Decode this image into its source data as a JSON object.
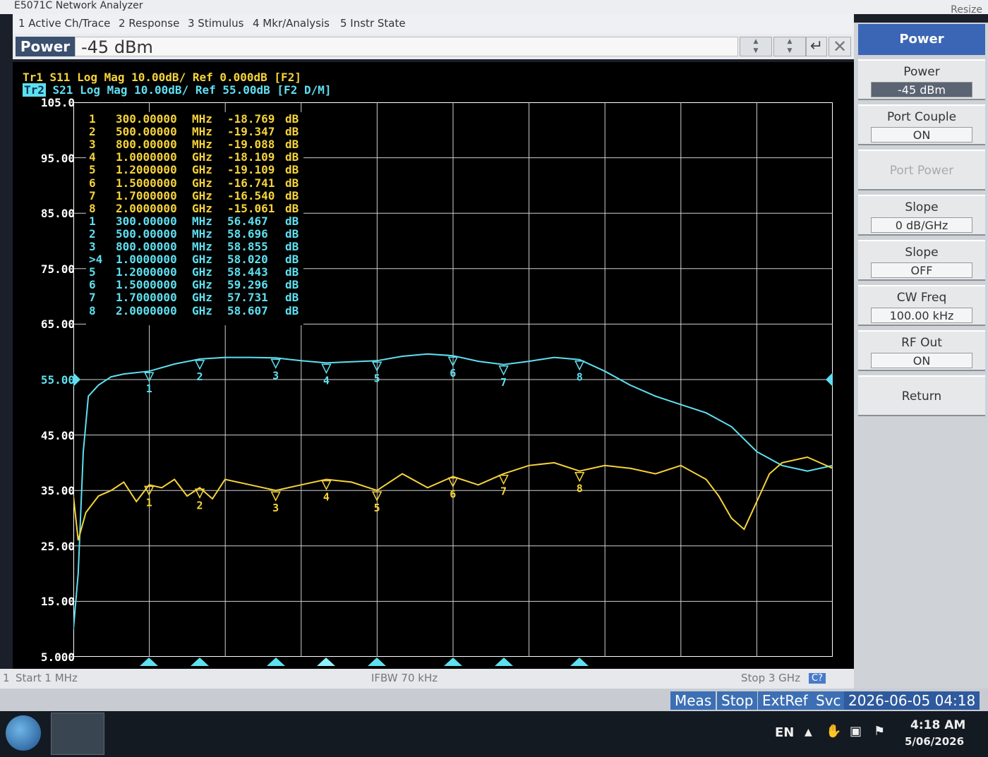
{
  "app": {
    "title": "E5071C Network Analyzer",
    "resize_label": "Resize"
  },
  "menu": [
    {
      "label": "1 Active Ch/Trace"
    },
    {
      "label": "2 Response"
    },
    {
      "label": "3 Stimulus"
    },
    {
      "label": "4 Mkr/Analysis"
    },
    {
      "label": "5 Instr State"
    }
  ],
  "entry": {
    "label": "Power",
    "value": "-45 dBm",
    "enter_icon": "enter-arrow-icon",
    "close_icon": "close-x-icon"
  },
  "traces": {
    "tr1": {
      "tag": "Tr1",
      "text": " S11 Log Mag 10.00dB/ Ref 0.000dB [F2]",
      "color": "#f5d33a"
    },
    "tr2": {
      "tag": "Tr2",
      "text": " S21 Log Mag 10.00dB/ Ref 55.00dB [F2 D/M]",
      "color": "#5ee0f0"
    }
  },
  "yaxis": {
    "labels": [
      "105.0",
      "95.00",
      "85.00",
      "75.00",
      "65.00",
      "55.00",
      "45.00",
      "35.00",
      "25.00",
      "15.00",
      "5.000"
    ],
    "reference": "55.00"
  },
  "markers_s11": [
    {
      "n": "1",
      "freq": "300.00000",
      "unit": "MHz",
      "value": "-18.769",
      "db": "dB"
    },
    {
      "n": "2",
      "freq": "500.00000",
      "unit": "MHz",
      "value": "-19.347",
      "db": "dB"
    },
    {
      "n": "3",
      "freq": "800.00000",
      "unit": "MHz",
      "value": "-19.088",
      "db": "dB"
    },
    {
      "n": "4",
      "freq": "1.0000000",
      "unit": "GHz",
      "value": "-18.109",
      "db": "dB"
    },
    {
      "n": "5",
      "freq": "1.2000000",
      "unit": "GHz",
      "value": "-19.109",
      "db": "dB"
    },
    {
      "n": "6",
      "freq": "1.5000000",
      "unit": "GHz",
      "value": "-16.741",
      "db": "dB"
    },
    {
      "n": "7",
      "freq": "1.7000000",
      "unit": "GHz",
      "value": "-16.540",
      "db": "dB"
    },
    {
      "n": "8",
      "freq": "2.0000000",
      "unit": "GHz",
      "value": "-15.061",
      "db": "dB"
    }
  ],
  "markers_s21": [
    {
      "n": "1",
      "freq": "300.00000",
      "unit": "MHz",
      "value": "56.467",
      "db": "dB"
    },
    {
      "n": "2",
      "freq": "500.00000",
      "unit": "MHz",
      "value": "58.696",
      "db": "dB"
    },
    {
      "n": "3",
      "freq": "800.00000",
      "unit": "MHz",
      "value": "58.855",
      "db": "dB"
    },
    {
      "n": ">4",
      "freq": "1.0000000",
      "unit": "GHz",
      "value": "58.020",
      "db": "dB"
    },
    {
      "n": "5",
      "freq": "1.2000000",
      "unit": "GHz",
      "value": "58.443",
      "db": "dB"
    },
    {
      "n": "6",
      "freq": "1.5000000",
      "unit": "GHz",
      "value": "59.296",
      "db": "dB"
    },
    {
      "n": "7",
      "freq": "1.7000000",
      "unit": "GHz",
      "value": "57.731",
      "db": "dB"
    },
    {
      "n": "8",
      "freq": "2.0000000",
      "unit": "GHz",
      "value": "58.607",
      "db": "dB"
    }
  ],
  "chart_data": {
    "type": "line",
    "xlim": [
      0.001,
      3.0
    ],
    "ylim": [
      5,
      105
    ],
    "x_unit": "GHz",
    "series": [
      {
        "name": "S21",
        "color": "#5ee0f0",
        "x": [
          0.001,
          0.02,
          0.04,
          0.06,
          0.1,
          0.15,
          0.2,
          0.3,
          0.4,
          0.5,
          0.6,
          0.7,
          0.8,
          0.9,
          1.0,
          1.1,
          1.2,
          1.3,
          1.4,
          1.5,
          1.6,
          1.7,
          1.8,
          1.9,
          2.0,
          2.1,
          2.2,
          2.3,
          2.4,
          2.5,
          2.6,
          2.7,
          2.8,
          2.9,
          3.0
        ],
        "y": [
          10,
          20,
          42,
          52,
          54,
          55.5,
          56,
          56.5,
          57.8,
          58.7,
          59.0,
          59.0,
          58.9,
          58.4,
          58.0,
          58.2,
          58.4,
          59.2,
          59.6,
          59.3,
          58.3,
          57.7,
          58.3,
          59.0,
          58.6,
          56.5,
          54.0,
          52.0,
          50.5,
          49.0,
          46.5,
          42.0,
          39.5,
          38.5,
          39.5
        ]
      },
      {
        "name": "S11",
        "color": "#f5d33a",
        "x": [
          0.001,
          0.02,
          0.05,
          0.1,
          0.15,
          0.2,
          0.25,
          0.3,
          0.35,
          0.4,
          0.45,
          0.5,
          0.55,
          0.6,
          0.7,
          0.8,
          0.9,
          1.0,
          1.1,
          1.2,
          1.3,
          1.4,
          1.5,
          1.6,
          1.7,
          1.8,
          1.9,
          2.0,
          2.1,
          2.2,
          2.3,
          2.4,
          2.5,
          2.55,
          2.6,
          2.65,
          2.7,
          2.75,
          2.8,
          2.9,
          3.0
        ],
        "y": [
          34,
          26,
          31,
          34,
          35,
          36.5,
          33,
          36,
          35.5,
          37,
          34,
          35.5,
          33.5,
          37,
          36,
          35,
          36,
          37,
          36.5,
          35,
          38,
          35.5,
          37.5,
          36,
          38,
          39.5,
          40,
          38.5,
          39.5,
          39,
          38,
          39.5,
          37,
          34,
          30,
          28,
          33,
          38,
          40,
          41,
          39
        ]
      }
    ]
  },
  "bottom_markers": [
    "1",
    "2",
    "3",
    "4",
    "5",
    "6",
    "7",
    "8"
  ],
  "status": {
    "channel": "1",
    "start": "Start 1 MHz",
    "ifbw": "IFBW 70 kHz",
    "stop": "Stop 3 GHz",
    "help": "C?"
  },
  "sysbar": {
    "meas": "Meas",
    "stop": "Stop",
    "extref": "ExtRef",
    "svc": "Svc",
    "datetime": "2026-06-05 04:18"
  },
  "softkeys": {
    "header": "Power",
    "items": [
      {
        "label": "Power",
        "value": "-45 dBm",
        "enabled": true
      },
      {
        "label": "Port Couple",
        "value": "ON",
        "enabled": true
      },
      {
        "label": "Port Power",
        "value": "",
        "enabled": false
      },
      {
        "label": "Slope",
        "value": "0 dB/GHz",
        "enabled": true
      },
      {
        "label": "Slope",
        "value": "OFF",
        "enabled": true
      },
      {
        "label": "CW Freq",
        "value": "100.00 kHz",
        "enabled": true
      },
      {
        "label": "RF Out",
        "value": "ON",
        "enabled": true
      },
      {
        "label": "Return",
        "value": "",
        "enabled": true
      }
    ]
  },
  "taskbar": {
    "lang": "EN",
    "time": "4:18 AM",
    "date": "5/06/2026"
  }
}
